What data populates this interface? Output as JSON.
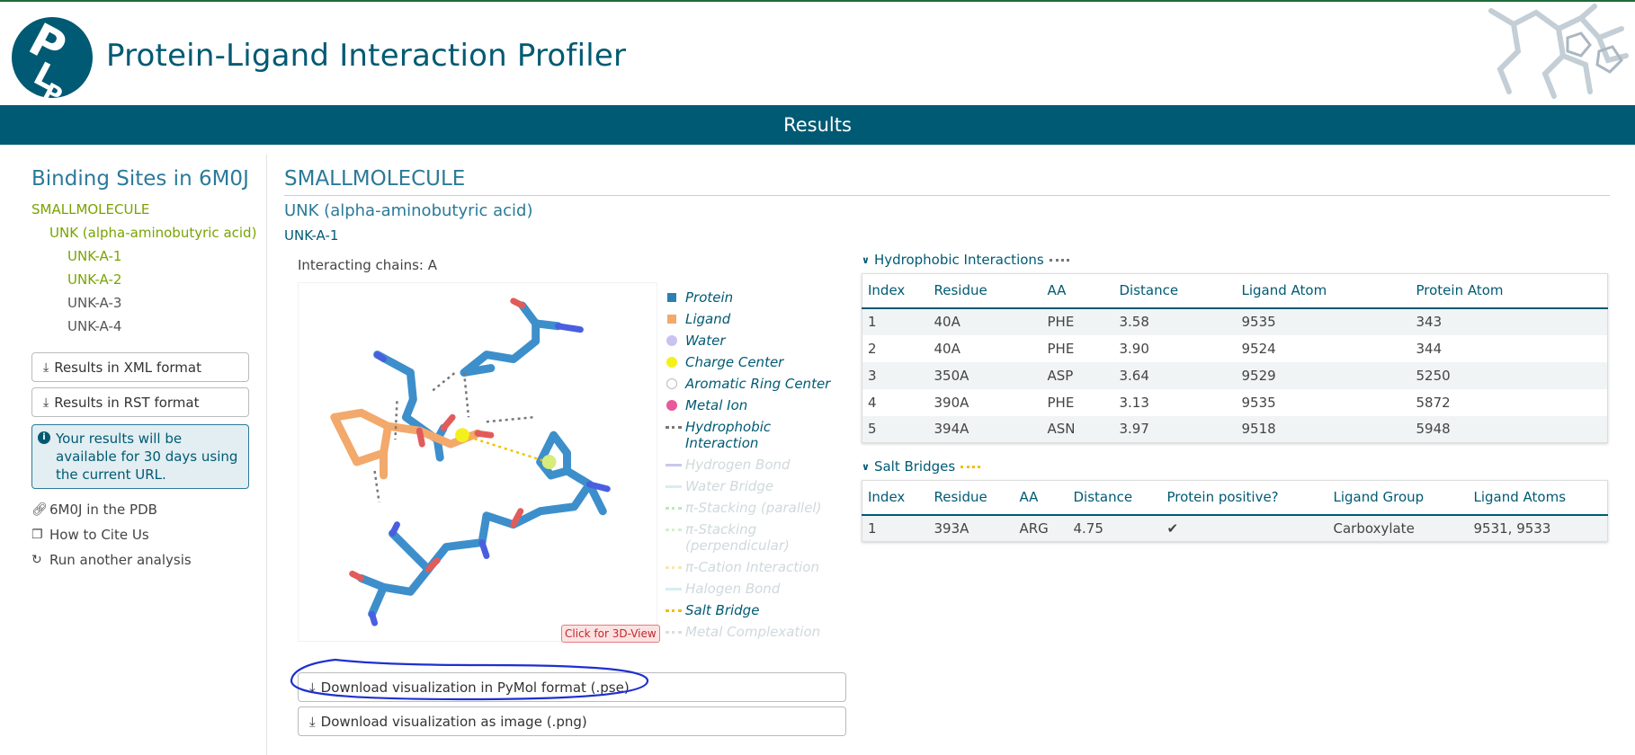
{
  "app": {
    "title": "Protein-Ligand Interaction Profiler",
    "banner": "Results"
  },
  "sidebar": {
    "title": "Binding Sites in 6M0J",
    "category": "SMALLMOLECULE",
    "ligand": "UNK (alpha-aminobutyric acid)",
    "sites": [
      "UNK-A-1",
      "UNK-A-2",
      "UNK-A-3",
      "UNK-A-4"
    ],
    "xml_button": "Results in XML format",
    "rst_button": "Results in RST format",
    "info": "Your results will be available for 30 days using the current URL.",
    "links": [
      "6M0J in the PDB",
      "How to Cite Us",
      "Run another analysis"
    ]
  },
  "main": {
    "title": "SMALLMOLECULE",
    "subtitle": "UNK (alpha-aminobutyric acid)",
    "site": "UNK-A-1",
    "chains": "Interacting chains: A",
    "click3d": "Click for 3D-View",
    "download_pse": "Download visualization in PyMol format (.pse)",
    "download_png": "Download visualization as image (.png)"
  },
  "legend": [
    {
      "label": "Protein",
      "faded": false,
      "kind": "square",
      "color": "#2b7fb2"
    },
    {
      "label": "Ligand",
      "faded": false,
      "kind": "square",
      "color": "#f2a96b"
    },
    {
      "label": "Water",
      "faded": false,
      "kind": "dot",
      "color": "#c8c4ef"
    },
    {
      "label": "Charge Center",
      "faded": false,
      "kind": "dot",
      "color": "#f3f01e"
    },
    {
      "label": "Aromatic Ring Center",
      "faded": false,
      "kind": "ring",
      "color": "#bbbbbb"
    },
    {
      "label": "Metal Ion",
      "faded": false,
      "kind": "dot",
      "color": "#e8589a"
    },
    {
      "label": "Hydrophobic Interaction",
      "faded": false,
      "kind": "dots",
      "color": "#777777"
    },
    {
      "label": "Hydrogen Bond",
      "faded": true,
      "kind": "line",
      "color": "#c9c7ee"
    },
    {
      "label": "Water Bridge",
      "faded": true,
      "kind": "line",
      "color": "#d8ecf3"
    },
    {
      "label": "π-Stacking (parallel)",
      "faded": true,
      "kind": "dots",
      "color": "#bfe6bf"
    },
    {
      "label": "π-Stacking (perpendicular)",
      "faded": true,
      "kind": "dots",
      "color": "#d6eed6"
    },
    {
      "label": "π-Cation Interaction",
      "faded": true,
      "kind": "dots",
      "color": "#f5e6b6"
    },
    {
      "label": "Halogen Bond",
      "faded": true,
      "kind": "line",
      "color": "#d6eef0"
    },
    {
      "label": "Salt Bridge",
      "faded": false,
      "kind": "dots",
      "color": "#f2c000"
    },
    {
      "label": "Metal Complexation",
      "faded": true,
      "kind": "dots",
      "color": "#dddddd"
    }
  ],
  "hydrophobic": {
    "title": "Hydrophobic Interactions",
    "headers": [
      "Index",
      "Residue",
      "AA",
      "Distance",
      "Ligand Atom",
      "Protein Atom"
    ],
    "rows": [
      [
        "1",
        "40A",
        "PHE",
        "3.58",
        "9535",
        "343"
      ],
      [
        "2",
        "40A",
        "PHE",
        "3.90",
        "9524",
        "344"
      ],
      [
        "3",
        "350A",
        "ASP",
        "3.64",
        "9529",
        "5250"
      ],
      [
        "4",
        "390A",
        "PHE",
        "3.13",
        "9535",
        "5872"
      ],
      [
        "5",
        "394A",
        "ASN",
        "3.97",
        "9518",
        "5948"
      ]
    ]
  },
  "salt": {
    "title": "Salt Bridges",
    "headers": [
      "Index",
      "Residue",
      "AA",
      "Distance",
      "Protein positive?",
      "Ligand Group",
      "Ligand Atoms"
    ],
    "rows": [
      [
        "1",
        "393A",
        "ARG",
        "4.75",
        "✔",
        "Carboxylate",
        "9531, 9533"
      ]
    ]
  }
}
